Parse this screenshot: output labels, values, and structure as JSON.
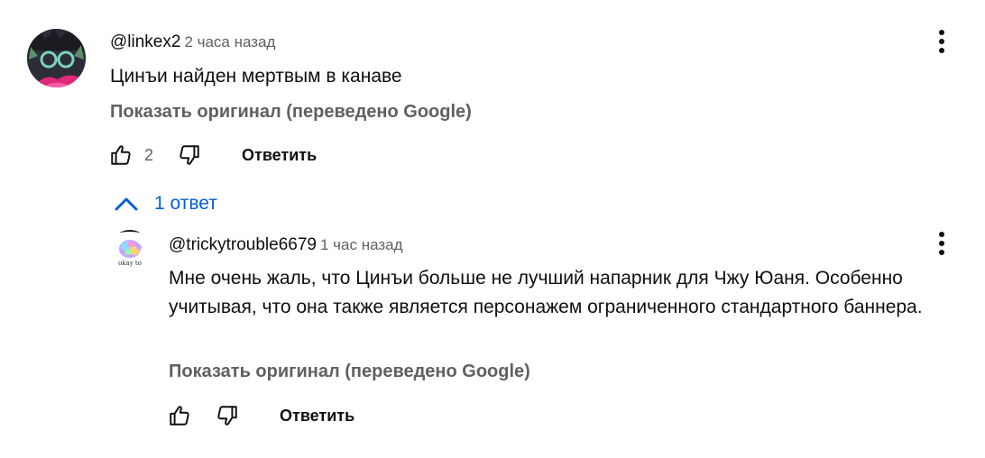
{
  "comment": {
    "handle": "@linkex2",
    "time": "2 часа назад",
    "text": "Цинъи найден мертвым в канаве",
    "translate_link": "Показать оригинал (переведено Google)",
    "like_count": "2",
    "reply_label": "Ответить"
  },
  "replies_toggle": {
    "label": "1 ответ"
  },
  "reply": {
    "handle": "@trickytrouble6679",
    "time": "1 час назад",
    "text": "Мне очень жаль, что Цинъи больше не лучший напарник для Чжу Юаня. Особенно учитывая, что она также является персонажем ограниченного стандартного баннера.",
    "translate_link": "Показать оригинал (переведено Google)",
    "reply_label": "Ответить",
    "avatar_text": "okay to"
  },
  "icons": {
    "like": "thumbs-up-icon",
    "dislike": "thumbs-down-icon",
    "menu": "more-vert-icon",
    "expand": "chevron-up-icon"
  },
  "colors": {
    "link_blue": "#065fd4",
    "secondary_text": "#606060",
    "primary_text": "#0f0f0f"
  }
}
